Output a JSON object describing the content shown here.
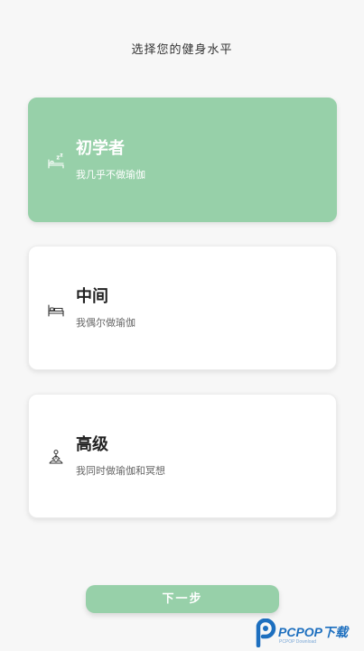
{
  "page": {
    "title": "选择您的健身水平"
  },
  "levels": [
    {
      "title": "初学者",
      "description": "我几乎不做瑜伽",
      "icon": "sleeping-bed-icon",
      "selected": true
    },
    {
      "title": "中间",
      "description": "我偶尔做瑜伽",
      "icon": "bed-icon",
      "selected": false
    },
    {
      "title": "高级",
      "description": "我同时做瑜伽和冥想",
      "icon": "meditation-icon",
      "selected": false
    }
  ],
  "next_button": {
    "label": "下一步"
  },
  "watermark": {
    "text": "PCPOP下载",
    "sub": "PCPOP Download"
  },
  "colors": {
    "accent": "#97d0a9",
    "background": "#f7f7f7",
    "card": "#ffffff",
    "watermark_blue": "#1d6fbf"
  }
}
